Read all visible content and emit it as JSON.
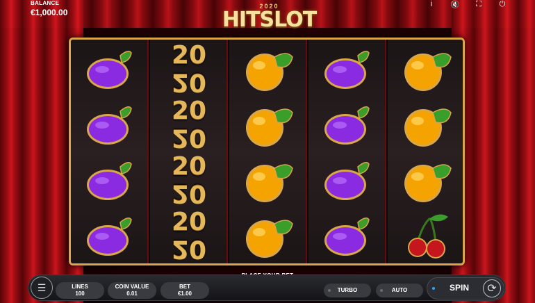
{
  "header": {
    "balance_label": "BALANCE",
    "balance_value": "€1,000.00",
    "logo_year": "2020",
    "logo_name": "HITSLOT",
    "icons": [
      "info-icon",
      "mute-icon",
      "fullscreen-icon",
      "power-icon"
    ],
    "icon_glyphs": [
      "i",
      "🔇",
      "⛶",
      "⏻"
    ]
  },
  "reels": [
    [
      "plum",
      "plum",
      "plum",
      "plum"
    ],
    [
      "2020",
      "2020",
      "2020",
      "2020"
    ],
    [
      "orange",
      "orange",
      "orange",
      "orange"
    ],
    [
      "plum",
      "plum",
      "plum",
      "plum"
    ],
    [
      "orange",
      "orange",
      "orange",
      "cherries"
    ]
  ],
  "reel2_text": "20",
  "footer": {
    "place_bet": "PLACE YOUR BET",
    "lines_label": "LINES",
    "lines_value": "100",
    "coin_label": "COIN VALUE",
    "coin_value": "0.01",
    "bet_label": "BET",
    "bet_value": "€1.00",
    "turbo_label": "TURBO",
    "auto_label": "AUTO",
    "spin_label": "SPIN"
  },
  "colors": {
    "frame_gold": "#d9a64a",
    "plum": "#8a2be2",
    "orange": "#f5a300",
    "leaf": "#3a9e2a",
    "cherry": "#c4161c",
    "spin_dot": "#2aa6ff"
  }
}
